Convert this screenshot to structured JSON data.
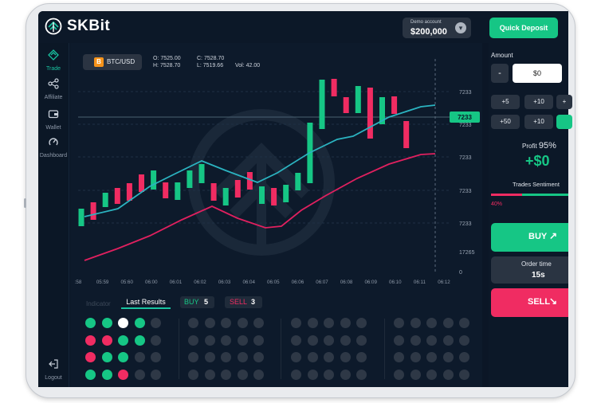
{
  "app": {
    "name": "SKBit"
  },
  "header": {
    "demo_label": "Demo account",
    "demo_balance": "$200,000",
    "quick_deposit": "Quick Deposit"
  },
  "sidebar": {
    "items": [
      {
        "label": "Trade",
        "icon": "trade-icon",
        "active": true
      },
      {
        "label": "Affiliate",
        "icon": "share-icon",
        "active": false
      },
      {
        "label": "Wallet",
        "icon": "wallet-icon",
        "active": false
      },
      {
        "label": "Dashboard",
        "icon": "gauge-icon",
        "active": false
      }
    ],
    "logout": "Logout"
  },
  "chart": {
    "pair": "BTC/USD",
    "coin_symbol": "B",
    "ohlc": {
      "o": "O: 7525.00",
      "c": "C: 7528.70",
      "h": "H: 7528.70",
      "l": "L: 7519.66",
      "vol": "Vol: 42.00"
    },
    "current_price": "7233"
  },
  "chart_data": {
    "type": "candlestick",
    "x_ticks": [
      ":58",
      "05:59",
      "05:60",
      "06:00",
      "06:01",
      "06:02",
      "06:03",
      "06:04",
      "06:05",
      "06:06",
      "06:07",
      "06:08",
      "06:09",
      "06:10",
      "06:11",
      "06:12"
    ],
    "y_ticks": [
      "7233",
      "7233",
      "7233",
      "7233",
      "7233",
      "17265",
      "0"
    ],
    "current_price_label": "7233",
    "candles": [
      {
        "color": "green"
      },
      {
        "color": "red"
      },
      {
        "color": "green"
      },
      {
        "color": "red"
      },
      {
        "color": "red"
      },
      {
        "color": "red"
      },
      {
        "color": "green"
      },
      {
        "color": "red"
      },
      {
        "color": "green"
      },
      {
        "color": "green"
      },
      {
        "color": "green"
      },
      {
        "color": "red"
      },
      {
        "color": "green"
      },
      {
        "color": "red"
      },
      {
        "color": "red"
      },
      {
        "color": "green"
      },
      {
        "color": "red"
      },
      {
        "color": "green"
      },
      {
        "color": "green"
      },
      {
        "color": "green"
      },
      {
        "color": "green"
      },
      {
        "color": "red"
      },
      {
        "color": "red"
      },
      {
        "color": "green"
      },
      {
        "color": "red"
      },
      {
        "color": "green"
      },
      {
        "color": "red"
      },
      {
        "color": "red"
      }
    ],
    "series": [
      {
        "color": "#2bb3c0"
      },
      {
        "color": "#e0205f"
      }
    ]
  },
  "results": {
    "tab_indicator": "Indicator",
    "tab_last": "Last Results",
    "buy_label": "BUY",
    "buy_count": "5",
    "sell_label": "SELL",
    "sell_count": "3",
    "group1": [
      [
        "green",
        "green",
        "white",
        "green",
        "gray"
      ],
      [
        "red",
        "red",
        "green",
        "green",
        "gray"
      ],
      [
        "red",
        "green",
        "green",
        "gray",
        "gray"
      ],
      [
        "green",
        "green",
        "red",
        "gray",
        "gray"
      ]
    ],
    "colors": {
      "green": "#16c685",
      "red": "#f02c62",
      "white": "#ffffff",
      "gray": "#2e3846"
    }
  },
  "panel": {
    "amount_label": "Amount",
    "minus": "-",
    "amount_value": "$0",
    "chips": [
      "+5",
      "+10",
      "+",
      "+50",
      "+10",
      ""
    ],
    "profit_label": "Profit",
    "profit_pct": "95%",
    "profit_value": "+$0",
    "sentiment_label": "Trades Sentiment",
    "sentiment_pct": "40%",
    "sentiment_value": 0.4,
    "buy": "BUY",
    "order_label": "Order time",
    "order_value": "15s",
    "sell": "SELL"
  }
}
